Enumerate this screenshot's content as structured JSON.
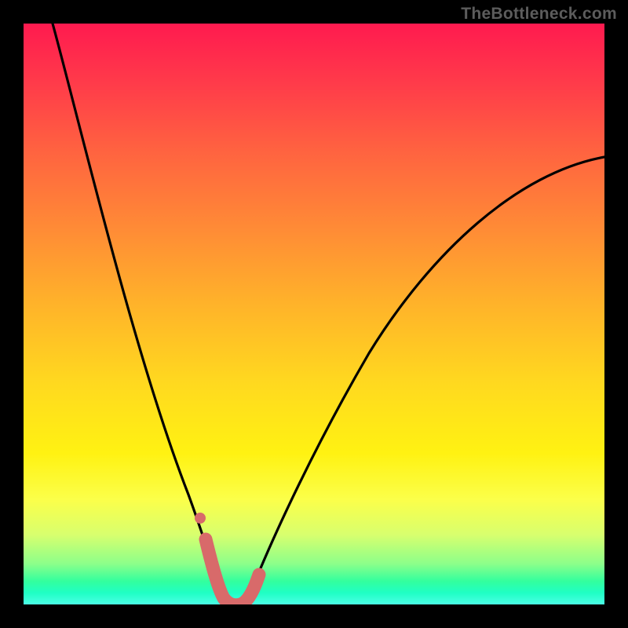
{
  "attribution": "TheBottleneck.com",
  "chart_data": {
    "type": "line",
    "title": "",
    "xlabel": "",
    "ylabel": "",
    "xlim": [
      0,
      100
    ],
    "ylim": [
      0,
      100
    ],
    "series": [
      {
        "name": "bottleneck-curve",
        "x": [
          5,
          8,
          11,
          14,
          17,
          20,
          23,
          26,
          29,
          31,
          32,
          33,
          34,
          35,
          36,
          37,
          38,
          40,
          43,
          47,
          52,
          58,
          64,
          70,
          76,
          83,
          90,
          97,
          100
        ],
        "y": [
          100,
          91,
          82,
          73,
          64,
          55,
          46,
          37,
          27,
          18,
          13,
          9,
          5,
          2,
          0,
          0,
          1,
          3,
          9,
          17,
          26,
          36,
          45,
          53,
          60,
          66,
          71,
          75,
          77
        ]
      },
      {
        "name": "highlight-segment",
        "x": [
          30,
          31,
          32,
          33,
          34,
          35,
          36,
          37,
          38,
          39
        ],
        "y": [
          13,
          9,
          5,
          2,
          0,
          0,
          0,
          1,
          2,
          4
        ]
      }
    ],
    "colors": {
      "curve": "#000000",
      "highlight": "#d86a6a",
      "gradient_top": "#ff1a4f",
      "gradient_bottom": "#4cffe6",
      "frame": "#000000"
    }
  }
}
